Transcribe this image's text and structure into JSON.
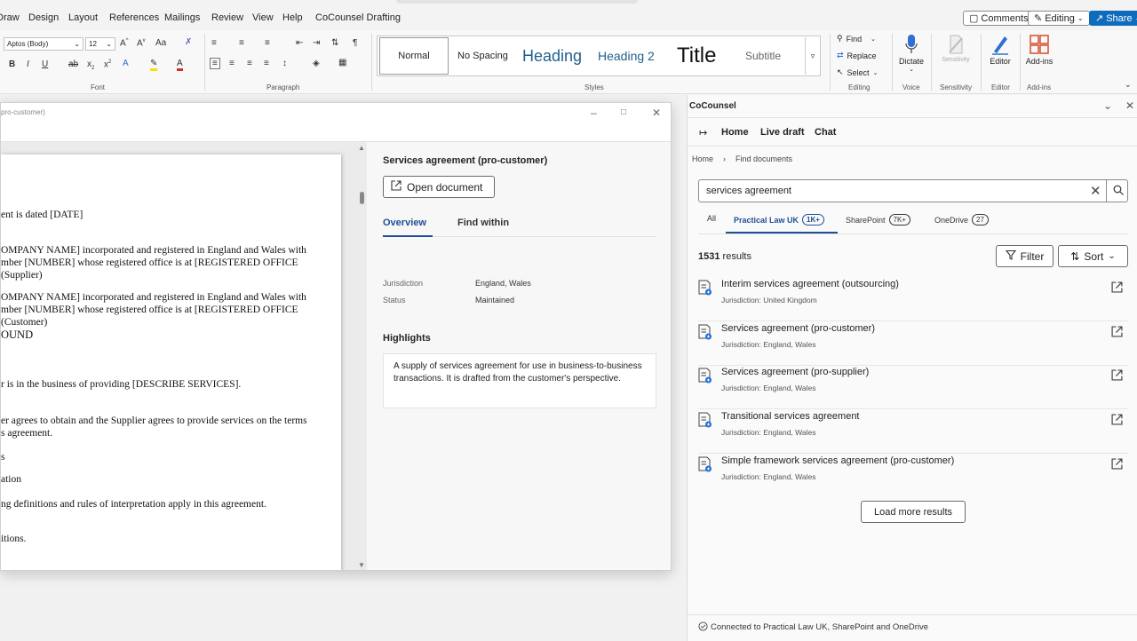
{
  "ribbon": {
    "tabs": [
      "Draw",
      "Design",
      "Layout",
      "References",
      "Mailings",
      "Review",
      "View",
      "Help",
      "CoCounsel Drafting"
    ],
    "comments_label": "Comments",
    "editing_label": "Editing",
    "share_label": "Share",
    "font_name": "Aptos (Body)",
    "font_size": "12",
    "font_group_label": "Font",
    "paragraph_group_label": "Paragraph",
    "styles_group_label": "Styles",
    "editing_group_label": "Editing",
    "voice_group_label": "Voice",
    "sensitivity_group_label": "Sensitivity",
    "editor_group_label": "Editor",
    "addins_group_label": "Add-ins",
    "styles": {
      "normal": "Normal",
      "no_spacing": "No Spacing",
      "heading1": "Heading",
      "heading2": "Heading 2",
      "title": "Title",
      "subtitle": "Subtitle"
    },
    "find_label": "Find",
    "replace_label": "Replace",
    "select_label": "Select",
    "dictate_label": "Dictate",
    "sensitivity_label": "Sensitivity",
    "editor_label": "Editor",
    "addins_label": "Add-ins"
  },
  "document_window": {
    "title_fragment": "pro-customer)",
    "page_lines": [
      "ent is dated [DATE]",
      "OMPANY NAME] incorporated and registered in England and Wales with",
      "mber [NUMBER] whose registered office is at [REGISTERED OFFICE",
      "(Supplier)",
      "OMPANY NAME] incorporated and registered in England and Wales with",
      "mber [NUMBER] whose registered office is at [REGISTERED OFFICE",
      "(Customer)",
      "OUND",
      "r is in the business of providing [DESCRIBE SERVICES].",
      "er agrees to obtain and the Supplier agrees to provide services on the terms",
      "s agreement.",
      "s",
      "ation",
      "ng definitions and rules of interpretation apply in this agreement.",
      "itions."
    ]
  },
  "preview": {
    "title": "Services agreement (pro-customer)",
    "open_button": "Open document",
    "tabs": [
      "Overview",
      "Find within"
    ],
    "fields": [
      {
        "key": "Jurisdiction",
        "value": "England, Wales"
      },
      {
        "key": "Status",
        "value": "Maintained"
      }
    ],
    "highlights_title": "Highlights",
    "highlights_text": "A supply of services agreement for use in business-to-business transactions. It is drafted from the customer's perspective."
  },
  "pane": {
    "title": "CoCounsel",
    "nav": [
      "Home",
      "Live draft",
      "Chat"
    ],
    "breadcrumb": [
      "Home",
      "Find documents"
    ],
    "search_value": "services agreement",
    "sources": [
      {
        "label": "All",
        "count": ""
      },
      {
        "label": "Practical Law UK",
        "count": "1K+"
      },
      {
        "label": "SharePoint",
        "count": "7K+"
      },
      {
        "label": "OneDrive",
        "count": "27"
      }
    ],
    "result_count": "1531",
    "result_count_suffix": " results",
    "filter_label": "Filter",
    "sort_label": "Sort",
    "results": [
      {
        "title": "Interim services agreement (outsourcing)",
        "subtitle": "Jurisdiction: United Kingdom"
      },
      {
        "title": "Services agreement (pro-customer)",
        "subtitle": "Jurisdiction: England, Wales"
      },
      {
        "title": "Services agreement (pro-supplier)",
        "subtitle": "Jurisdiction: England, Wales"
      },
      {
        "title": "Transitional services agreement",
        "subtitle": "Jurisdiction: England, Wales"
      },
      {
        "title": "Simple framework services agreement (pro-customer)",
        "subtitle": "Jurisdiction: England, Wales"
      }
    ],
    "load_more": "Load more results",
    "footer": "Connected to Practical Law UK, SharePoint and OneDrive"
  },
  "colors": {
    "accent": "#1f4e96",
    "share_blue": "#0f6cbd",
    "heading_blue": "#1f5f8b"
  }
}
